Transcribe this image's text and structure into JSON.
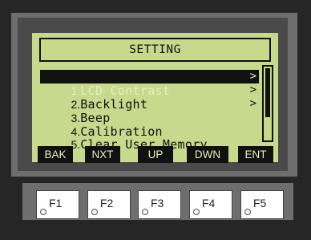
{
  "title": "SETTING",
  "menu": [
    {
      "num": "1.",
      "label": "LCD Contrast",
      "arrow": ">",
      "selected": true
    },
    {
      "num": "2.",
      "label": "Backlight",
      "arrow": ">",
      "selected": false
    },
    {
      "num": "3.",
      "label": "Beep",
      "arrow": ">",
      "selected": false
    },
    {
      "num": "4.",
      "label": "Calibration",
      "arrow": "",
      "selected": false
    },
    {
      "num": "5.",
      "label": "Clear User Memory",
      "arrow": "",
      "selected": false
    }
  ],
  "softkeys": [
    "BAK",
    "NXT",
    "UP",
    "DWN",
    "ENT"
  ],
  "function_keys": [
    "F1",
    "F2",
    "F3",
    "F4",
    "F5"
  ],
  "colors": {
    "lcd_background": "#c6d98c",
    "device_body": "#262626",
    "lcd_ink": "#111111"
  }
}
